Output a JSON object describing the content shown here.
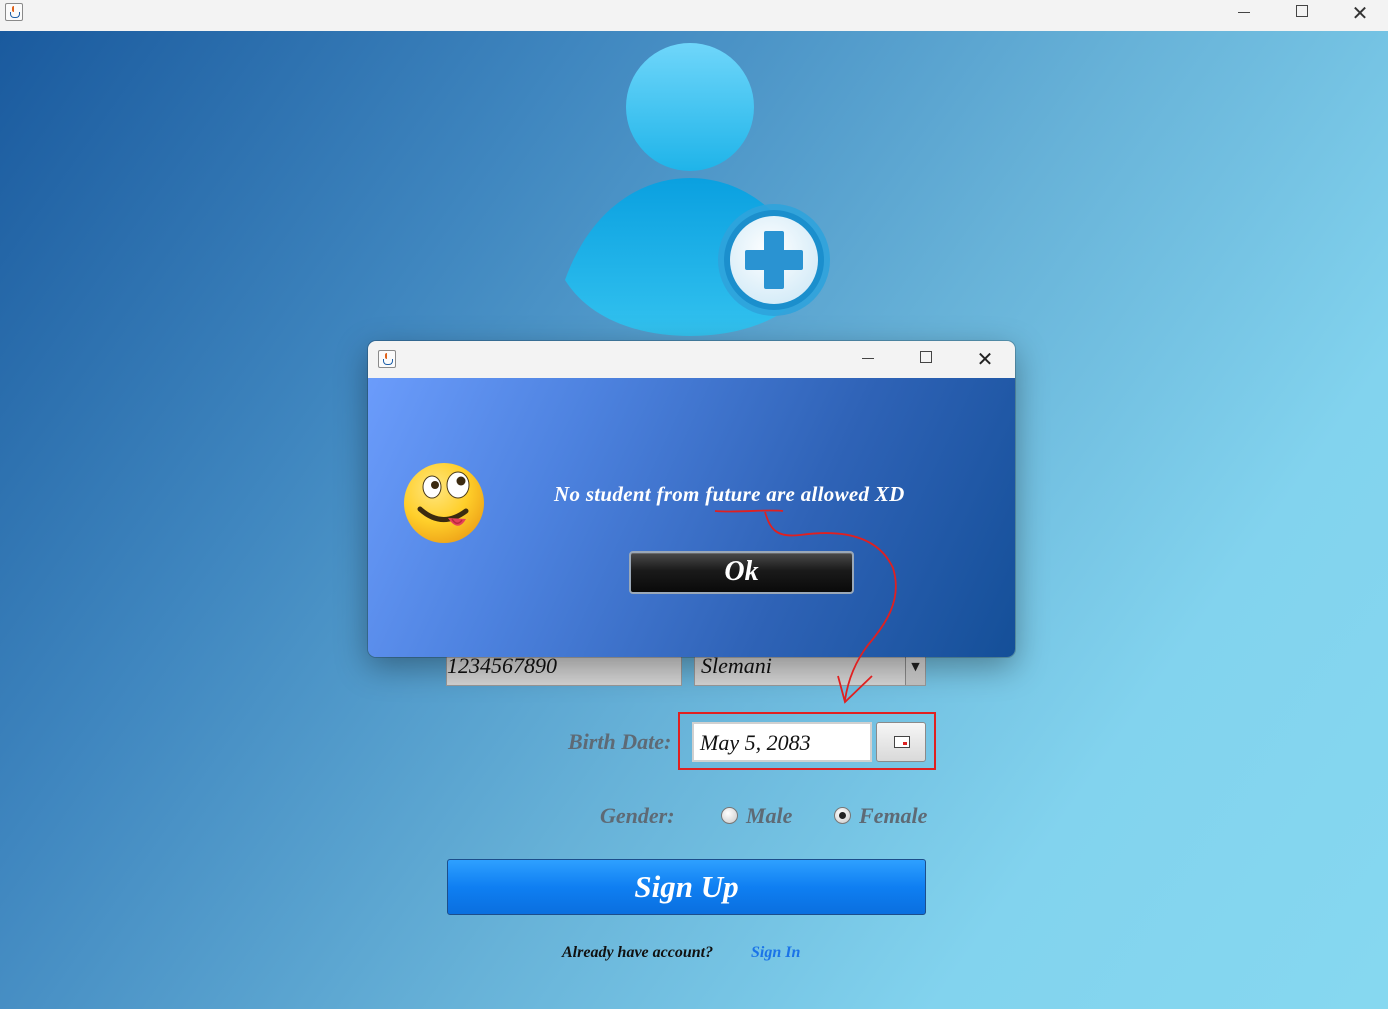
{
  "main_window": {
    "controls": {
      "minimize": "minimize",
      "maximize": "maximize",
      "close": "close"
    }
  },
  "form": {
    "phone_value": "1234567890",
    "city_value": "Slemani",
    "birth_date_label": "Birth Date:",
    "birth_date_value": "May 5, 2083",
    "gender_label": "Gender:",
    "gender_options": [
      {
        "label": "Male",
        "selected": false
      },
      {
        "label": "Female",
        "selected": true
      }
    ],
    "signup_label": "Sign Up",
    "already_text": "Already have account?",
    "signin_label": "Sign In"
  },
  "dialog": {
    "message": "No student from future are allowed XD",
    "ok_label": "Ok"
  },
  "colors": {
    "signup_button": "#0f7ff2",
    "link": "#1a73e8",
    "annotation": "#e02020",
    "avatar": "#1ab0e6"
  },
  "icons": {
    "app": "java-cup-icon",
    "avatar": "add-user-icon",
    "dialog_emoji": "silly-face-emoji-icon",
    "date_picker": "calendar-icon"
  }
}
